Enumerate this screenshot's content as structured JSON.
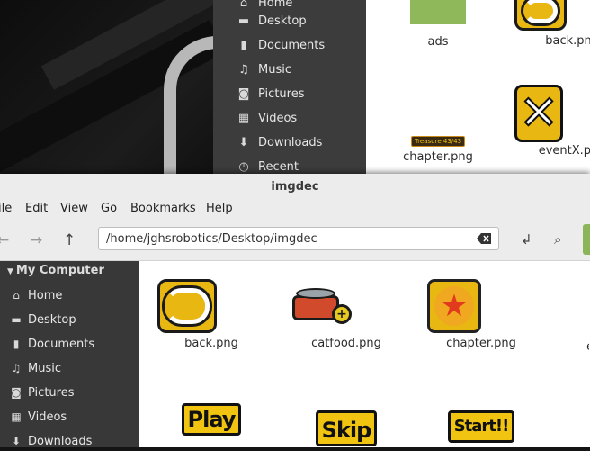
{
  "back_window": {
    "sidebar": [
      {
        "label": "Home",
        "icon": "home-icon"
      },
      {
        "label": "Desktop",
        "icon": "desktop-icon"
      },
      {
        "label": "Documents",
        "icon": "document-icon"
      },
      {
        "label": "Music",
        "icon": "music-icon"
      },
      {
        "label": "Pictures",
        "icon": "camera-icon"
      },
      {
        "label": "Videos",
        "icon": "film-icon"
      },
      {
        "label": "Downloads",
        "icon": "download-icon"
      },
      {
        "label": "Recent",
        "icon": "recent-icon"
      }
    ],
    "files": [
      {
        "name": "ads"
      },
      {
        "name": "back.pn"
      },
      {
        "name": "chapter.png"
      },
      {
        "name": "eventX.pn"
      }
    ],
    "treasure_text": "Treasure 43/43"
  },
  "window": {
    "title": "imgdec",
    "menu": [
      "ile",
      "Edit",
      "View",
      "Go",
      "Bookmarks",
      "Help"
    ],
    "path": "/home/jghsrobotics/Desktop/imgdec",
    "sidebar_heading": "My Computer",
    "sidebar": [
      {
        "label": "Home",
        "icon": "home-icon"
      },
      {
        "label": "Desktop",
        "icon": "desktop-icon"
      },
      {
        "label": "Documents",
        "icon": "document-icon"
      },
      {
        "label": "Music",
        "icon": "music-icon"
      },
      {
        "label": "Pictures",
        "icon": "camera-icon"
      },
      {
        "label": "Videos",
        "icon": "film-icon"
      },
      {
        "label": "Downloads",
        "icon": "download-icon"
      }
    ],
    "files": [
      {
        "name": "back.png"
      },
      {
        "name": "catfood.png"
      },
      {
        "name": "chapter.png"
      },
      {
        "name": "e"
      }
    ],
    "thumb_texts": {
      "play": "Play",
      "skip": "Skip",
      "start": "Start!!"
    }
  },
  "colors": {
    "accent_green": "#8bb558",
    "sidebar_bg": "#383838",
    "thumb_yellow": "#e8b711"
  }
}
